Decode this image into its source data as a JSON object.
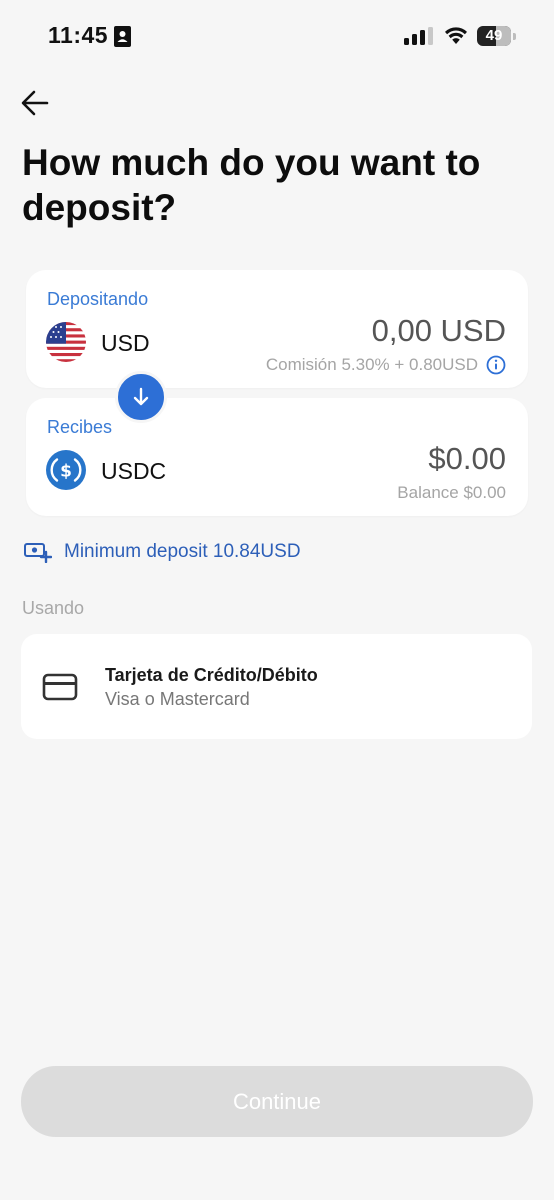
{
  "status_bar": {
    "time": "11:45",
    "battery": "49",
    "icons": [
      "contact-card-icon",
      "cellular-signal-icon",
      "wifi-icon",
      "battery-icon"
    ]
  },
  "header": {
    "back_icon": "arrow-left-icon",
    "title": "How much do you want to deposit?"
  },
  "deposit_from": {
    "label": "Depositando",
    "currency": "USD",
    "currency_icon": "us-flag-icon",
    "amount": "0,00 USD",
    "fee_note": "Comisión 5.30% + 0.80USD",
    "info_icon": "info-icon"
  },
  "swap_icon": "arrow-down-icon",
  "receive": {
    "label": "Recibes",
    "currency": "USDC",
    "currency_icon": "usdc-coin-icon",
    "amount": "$0.00",
    "balance": "Balance $0.00"
  },
  "minimum_deposit": {
    "icon": "cash-add-icon",
    "text": "Minimum deposit 10.84USD"
  },
  "payment": {
    "section_label": "Usando",
    "method_icon": "credit-card-icon",
    "method_title": "Tarjeta de Crédito/Débito",
    "method_subtitle": "Visa o Mastercard"
  },
  "continue_label": "Continue",
  "colors": {
    "accent_blue": "#2d6fd6",
    "label_blue": "#3a7bd5",
    "background": "#f6f6f6",
    "disabled_button": "#dcdcdc"
  }
}
